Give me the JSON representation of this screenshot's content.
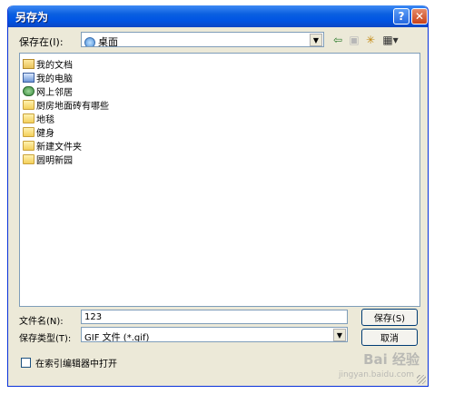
{
  "window": {
    "title": "另存为",
    "help": "?",
    "close": "✕"
  },
  "save_in": {
    "label": "保存在(I):",
    "value": "桌面",
    "arrow": "▼"
  },
  "toolbar": {
    "back": "⇦",
    "up": "▣",
    "new_folder": "✳",
    "views": "▦▾"
  },
  "files": [
    {
      "name": "我的文档",
      "icon": "documents-folder-icon"
    },
    {
      "name": "我的电脑",
      "icon": "my-computer-icon"
    },
    {
      "name": "网上邻居",
      "icon": "network-icon"
    },
    {
      "name": "厨房地面砖有哪些",
      "icon": "folder-icon"
    },
    {
      "name": "地毯",
      "icon": "folder-icon"
    },
    {
      "name": "健身",
      "icon": "folder-icon"
    },
    {
      "name": "新建文件夹",
      "icon": "folder-icon"
    },
    {
      "name": "圆明新园",
      "icon": "folder-icon"
    }
  ],
  "filename": {
    "label": "文件名(N):",
    "value": "123"
  },
  "filetype": {
    "label": "保存类型(T):",
    "value": "GIF 文件 (*.gif)",
    "arrow": "▼"
  },
  "buttons": {
    "save": "保存(S)",
    "cancel": "取消"
  },
  "open_in_index": {
    "label": "在索引编辑器中打开"
  },
  "watermark": {
    "text": "Bai 经验",
    "url": "jingyan.baidu.com"
  }
}
